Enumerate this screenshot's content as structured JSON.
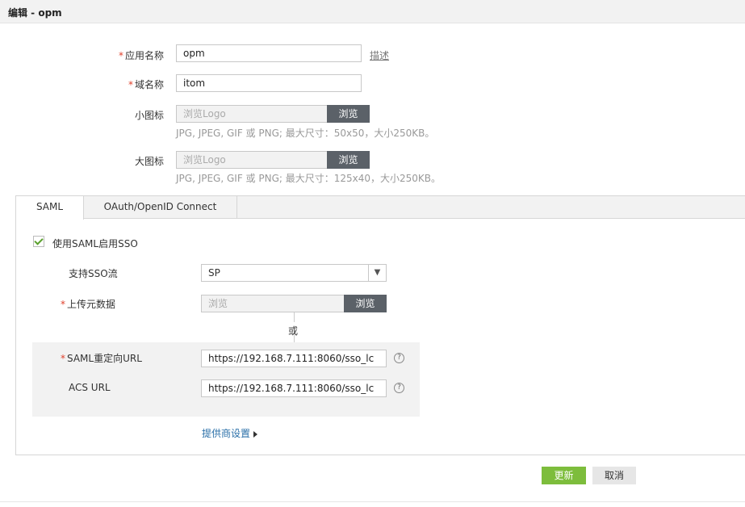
{
  "title": "编辑 - opm",
  "form": {
    "required_mark": "*",
    "app_name_label": "应用名称",
    "app_name_value": "opm",
    "describe_link": "描述",
    "domain_label": "域名称",
    "domain_value": "itom",
    "small_icon_label": "小图标",
    "small_icon_placeholder": "浏览Logo",
    "small_icon_hint": "JPG, JPEG, GIF 或 PNG; 最大尺寸：50x50，大小250KB。",
    "large_icon_label": "大图标",
    "large_icon_placeholder": "浏览Logo",
    "large_icon_hint": "JPG, JPEG, GIF 或 PNG; 最大尺寸：125x40，大小250KB。",
    "browse_label": "浏览"
  },
  "tabs": [
    {
      "label": "SAML",
      "active": true
    },
    {
      "label": "OAuth/OpenID Connect",
      "active": false
    }
  ],
  "saml": {
    "enable_sso_label": "使用SAML启用SSO",
    "enable_sso_checked": true,
    "sso_flow_label": "支持SSO流",
    "sso_flow_value": "SP",
    "upload_metadata_label": "上传元数据",
    "upload_placeholder": "浏览",
    "browse_label": "浏览",
    "or_label": "或",
    "redirect_url_label": "SAML重定向URL",
    "redirect_url_value": "https://192.168.7.111:8060/sso_lc",
    "acs_url_label": "ACS URL",
    "acs_url_value": "https://192.168.7.111:8060/sso_lc",
    "help_glyph": "?",
    "provider_settings_label": "提供商设置"
  },
  "actions": {
    "save_label": "更新",
    "cancel_label": "取消"
  },
  "colors": {
    "accent_green": "#7dbd3c",
    "required_red": "#e0412c",
    "browse_button": "#5b6168",
    "link_blue": "#2a6fa8"
  }
}
